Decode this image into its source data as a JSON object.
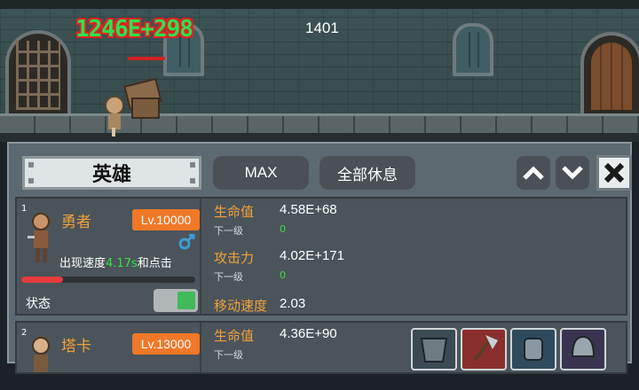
{
  "scene": {
    "damage_popup": "1246E+298",
    "counter": "1401"
  },
  "panel": {
    "tab_heroes": "英雄",
    "max_button": "MAX",
    "rest_all_button": "全部休息"
  },
  "heroes": [
    {
      "index": "1",
      "name": "勇者",
      "level": "Lv.10000",
      "appear_prefix": "出现速度",
      "appear_speed": "4.17s",
      "appear_suffix": "和点击",
      "hp_fraction": 0.24,
      "state_label": "状态",
      "state_on": true,
      "stats": {
        "hp_label": "生命值",
        "hp_value": "4.58E+68",
        "hp_next_label": "下一级",
        "hp_next_value": "0",
        "atk_label": "攻击力",
        "atk_value": "4.02E+171",
        "atk_next_label": "下一级",
        "atk_next_value": "0",
        "move_label": "移动速度",
        "move_value": "2.03"
      }
    },
    {
      "index": "2",
      "name": "塔卡",
      "level": "Lv.13000",
      "stats": {
        "hp_label": "生命值",
        "hp_value": "4.36E+90",
        "hp_next_label": "下一级"
      },
      "skills": [
        "armor-skill-icon",
        "axe-skill-icon",
        "gauntlet-skill-icon",
        "helmet-skill-icon"
      ]
    }
  ],
  "colors": {
    "label_orange": "#f0a03a",
    "level_badge": "#f07828",
    "green": "#38e042",
    "hp_red": "#e83b3b"
  }
}
